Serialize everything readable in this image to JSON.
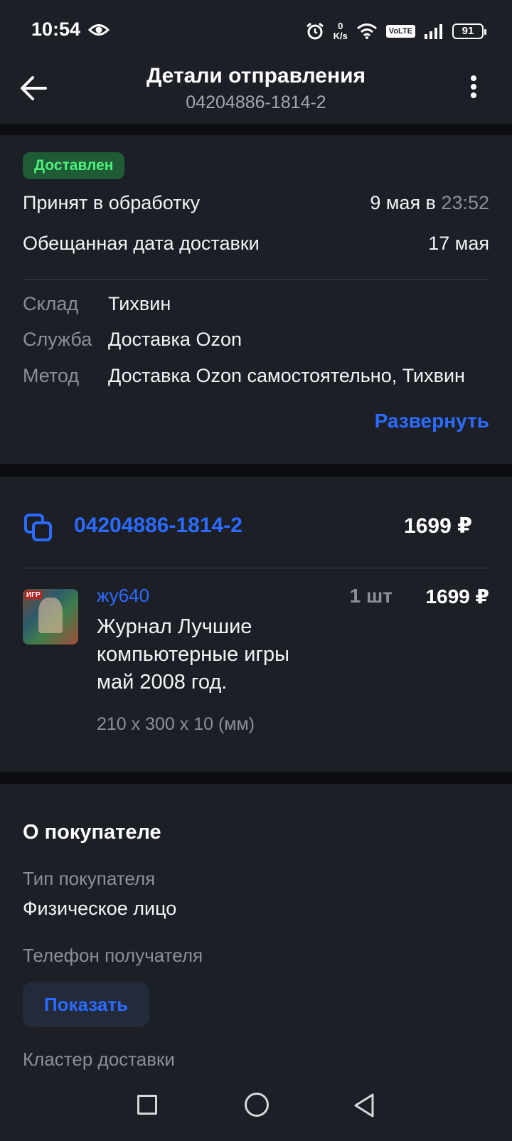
{
  "status_bar": {
    "time": "10:54",
    "net_speed_value": "0",
    "net_speed_unit": "K/s",
    "volte": "VoLTE",
    "battery": "91"
  },
  "header": {
    "title": "Детали отправления",
    "subtitle": "04204886-1814-2"
  },
  "shipment": {
    "status_badge": "Доставлен",
    "status_color": "#4ef07d",
    "accepted_label": "Принят в обработку",
    "accepted_date": "9 мая в",
    "accepted_time": "23:52",
    "promised_label": "Обещанная дата доставки",
    "promised_date": "17 мая",
    "warehouse_label": "Склад",
    "warehouse_value": "Тихвин",
    "service_label": "Служба",
    "service_value": "Доставка Ozon",
    "method_label": "Метод",
    "method_value": "Доставка Ozon самостоятельно, Тихвин",
    "expand_label": "Развернуть"
  },
  "posting": {
    "number": "04204886-1814-2",
    "total": "1699 ₽",
    "item": {
      "seller": "жу640",
      "name": "Журнал Лучшие компьютерные игры май 2008 год.",
      "dimensions": "210 x 300 x 10 (мм)",
      "quantity": "1 шт",
      "price": "1699 ₽"
    }
  },
  "buyer": {
    "title": "О покупателе",
    "type_label": "Тип покупателя",
    "type_value": "Физическое лицо",
    "phone_label": "Телефон получателя",
    "show_button": "Показать",
    "cluster_label": "Кластер доставки"
  },
  "colors": {
    "accent": "#2b6bff",
    "background": "#0c0e12",
    "card": "#1c1f26"
  }
}
